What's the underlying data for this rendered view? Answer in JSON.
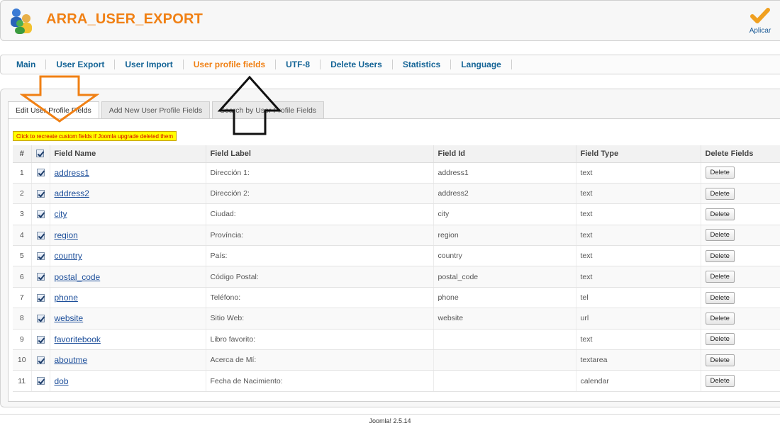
{
  "header": {
    "title": "ARRA_USER_EXPORT",
    "apply_label": "Aplicar",
    "logo_icon": "users-icon",
    "apply_icon": "checkmark-icon"
  },
  "menu": {
    "items": [
      {
        "label": "Main"
      },
      {
        "label": "User Export"
      },
      {
        "label": "User Import"
      },
      {
        "label": "User profile fields"
      },
      {
        "label": "UTF-8"
      },
      {
        "label": "Delete Users"
      },
      {
        "label": "Statistics"
      },
      {
        "label": "Language"
      }
    ],
    "active_index": 3
  },
  "tabs": [
    {
      "label": "Edit User Profile Fields"
    },
    {
      "label": "Add New User Profile Fields"
    },
    {
      "label": "Search by User Profile Fields"
    }
  ],
  "recreate_button": "Click to recreate custom fields if Joomla upgrade deleted them",
  "table": {
    "headers": {
      "num": "#",
      "field_name": "Field Name",
      "field_label": "Field Label",
      "field_id": "Field Id",
      "field_type": "Field Type",
      "delete": "Delete Fields"
    },
    "delete_label": "Delete",
    "rows": [
      {
        "num": "1",
        "name": "address1",
        "label": "Dirección 1:",
        "id": "address1",
        "type": "text"
      },
      {
        "num": "2",
        "name": "address2",
        "label": "Dirección 2:",
        "id": "address2",
        "type": "text"
      },
      {
        "num": "3",
        "name": "city",
        "label": "Ciudad:",
        "id": "city",
        "type": "text"
      },
      {
        "num": "4",
        "name": "region",
        "label": "Província:",
        "id": "region",
        "type": "text"
      },
      {
        "num": "5",
        "name": "country",
        "label": "País:",
        "id": "country",
        "type": "text"
      },
      {
        "num": "6",
        "name": "postal_code",
        "label": "Código Postal:",
        "id": "postal_code",
        "type": "text"
      },
      {
        "num": "7",
        "name": "phone",
        "label": "Teléfono:",
        "id": "phone",
        "type": "tel"
      },
      {
        "num": "8",
        "name": "website",
        "label": "Sitio Web:",
        "id": "website",
        "type": "url"
      },
      {
        "num": "9",
        "name": "favoritebook",
        "label": "Libro favorito:",
        "id": "",
        "type": "text"
      },
      {
        "num": "10",
        "name": "aboutme",
        "label": "Acerca de Mí:",
        "id": "",
        "type": "textarea"
      },
      {
        "num": "11",
        "name": "dob",
        "label": "Fecha de Nacimiento:",
        "id": "",
        "type": "calendar"
      }
    ]
  },
  "footer": "Joomla! 2.5.14",
  "colors": {
    "accent_orange": "#f08014",
    "link_blue": "#146496",
    "highlight_yellow": "#ffff00"
  }
}
